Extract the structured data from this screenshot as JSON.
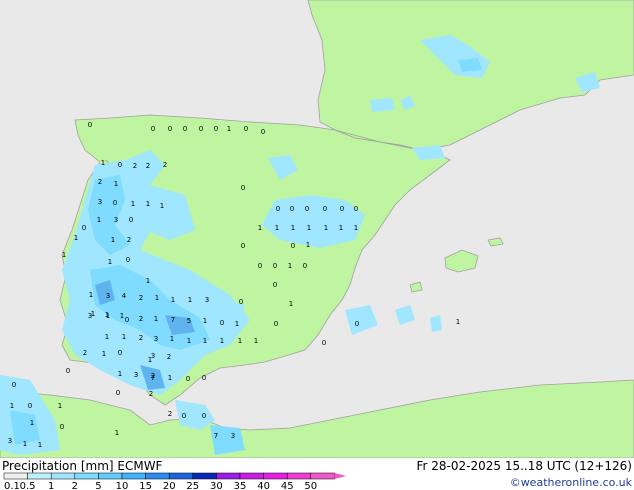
{
  "title": {
    "left": "Precipitation [mm]  ECMWF",
    "right": "Fr 28-02-2025 15..18 UTC (12+126)",
    "credit": "©weatheronline.co.uk"
  },
  "legend": {
    "ticks": [
      "0.1",
      "0.5",
      "1",
      "2",
      "5",
      "10",
      "15",
      "20",
      "25",
      "30",
      "35",
      "40",
      "45",
      "50"
    ],
    "colors": [
      "#f0f0f0",
      "#bff0ff",
      "#a0e6ff",
      "#7fdcff",
      "#5fcdff",
      "#40b4ff",
      "#2a8cf0",
      "#1e64dc",
      "#0a28b4",
      "#9b1ee6",
      "#c81ee6",
      "#e61ee6",
      "#f03cd2",
      "#f05ac8"
    ]
  },
  "colors": {
    "sea": "#e9e9e9",
    "land": "#bff5a0",
    "rain_light": "#a0e6ff",
    "rain_mid": "#7fdcff",
    "rain_heavy": "#5fb4f0",
    "border": "#a0a0a0"
  },
  "map_labels": [
    "0",
    "0",
    "0",
    "0",
    "0",
    "0",
    "1",
    "0",
    "0",
    "1",
    "0",
    "2",
    "2",
    "2",
    "0",
    "2",
    "1",
    "3",
    "0",
    "1",
    "1",
    "1",
    "1",
    "3",
    "0",
    "0",
    "0",
    "0",
    "0",
    "0",
    "0",
    "1",
    "1",
    "1",
    "1",
    "1",
    "1",
    "1",
    "0",
    "1",
    "2",
    "1",
    "0",
    "0",
    "1",
    "1",
    "0",
    "1",
    "1",
    "0",
    "0",
    "1",
    "0",
    "0",
    "1",
    "3",
    "4",
    "2",
    "1",
    "1",
    "1",
    "3",
    "0",
    "1",
    "1",
    "1",
    "0",
    "1",
    "3",
    "1",
    "2",
    "1",
    "7",
    "5",
    "1",
    "0",
    "1",
    "0",
    "1",
    "1",
    "2",
    "3",
    "1",
    "1",
    "1",
    "1",
    "1",
    "1",
    "0",
    "1",
    "0",
    "3",
    "2",
    "0",
    "1",
    "2",
    "1",
    "3",
    "2",
    "7",
    "1",
    "0",
    "0",
    "0",
    "2",
    "2",
    "0",
    "0",
    "1",
    "0",
    "1",
    "0",
    "3",
    "1",
    "1",
    "7",
    "3",
    "0",
    "1",
    "0",
    "1",
    "1"
  ]
}
